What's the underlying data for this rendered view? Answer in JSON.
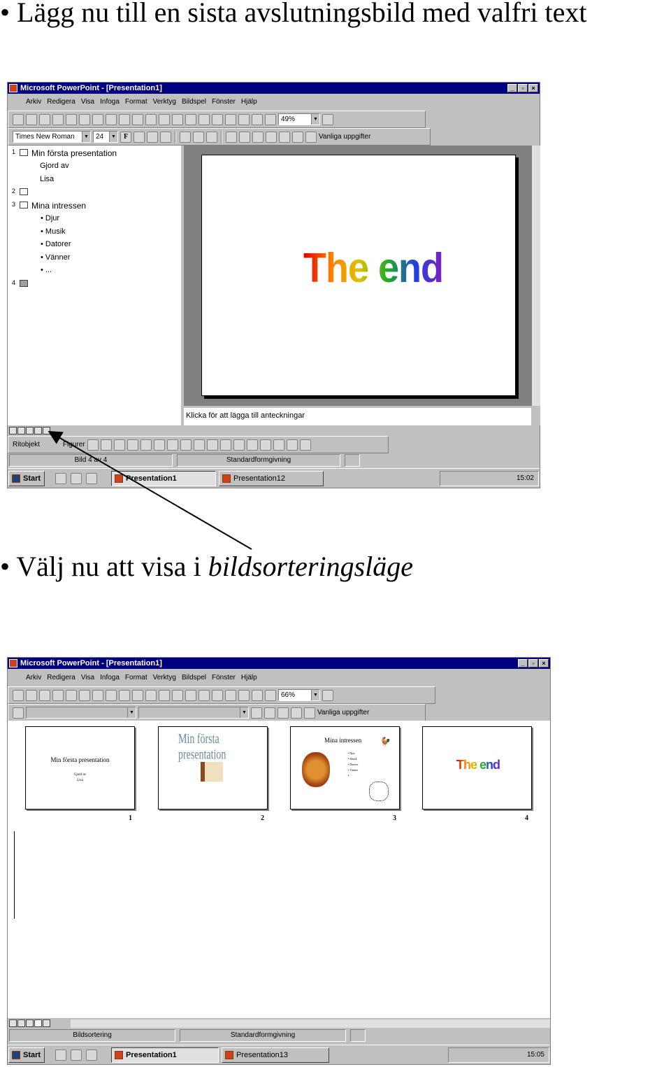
{
  "bullets": {
    "b1": "• Lägg nu till en sista avslutningsbild med valfri text",
    "b2_prefix": "• Välj nu att visa i ",
    "b2_italic": "bildsorteringsläge"
  },
  "shot1": {
    "title": "Microsoft PowerPoint - [Presentation1]",
    "menu": [
      "Arkiv",
      "Redigera",
      "Visa",
      "Infoga",
      "Format",
      "Verktyg",
      "Bildspel",
      "Fönster",
      "Hjälp"
    ],
    "zoom": "49%",
    "font": "Times New Roman",
    "size": "24",
    "task_pane": "Vanliga uppgifter",
    "outline": [
      {
        "num": "1",
        "title": "Min första presentation",
        "lines": [
          "Gjord av",
          "Lisa"
        ]
      },
      {
        "num": "2",
        "title": "",
        "lines": []
      },
      {
        "num": "3",
        "title": "Mina intressen",
        "lines": [
          "• Djur",
          "• Musik",
          "• Datorer",
          "• Vänner",
          "• ..."
        ]
      },
      {
        "num": "4",
        "title": "",
        "lines": []
      }
    ],
    "slide_text": "The end",
    "notes_placeholder": "Klicka för att lägga till anteckningar",
    "draw_label": "Ritobjekt",
    "shapes_label": "Figurer",
    "status_slide": "Bild 4 av 4",
    "status_design": "Standardformgivning",
    "start": "Start",
    "task1": "Presentation1",
    "task2": "Presentation12",
    "clock": "15:02"
  },
  "shot2": {
    "title": "Microsoft PowerPoint - [Presentation1]",
    "menu": [
      "Arkiv",
      "Redigera",
      "Visa",
      "Infoga",
      "Format",
      "Verktyg",
      "Bildspel",
      "Fönster",
      "Hjälp"
    ],
    "zoom": "66%",
    "task_pane": "Vanliga uppgifter",
    "thumbs": [
      {
        "num": "1",
        "title": "Min första presentation",
        "sub1": "Gjord av",
        "sub2": "Lisa"
      },
      {
        "num": "2",
        "title": "Min första presentation"
      },
      {
        "num": "3",
        "title": "Mina intressen",
        "bullets": [
          "• Djur",
          "• Musik",
          "• Datorer",
          "• Vänner",
          "•"
        ]
      },
      {
        "num": "4",
        "title": "The end"
      }
    ],
    "status_view": "Bildsortering",
    "status_design": "Standardformgivning",
    "start": "Start",
    "task1": "Presentation1",
    "task2": "Presentation13",
    "clock": "15:05"
  },
  "icons": {
    "toolbar1": [
      "new-icon",
      "open-icon",
      "save-icon",
      "email-icon",
      "print-icon",
      "spelling-icon",
      "cut-icon",
      "copy-icon",
      "paste-icon",
      "format-painter-icon",
      "undo-icon",
      "redo-icon",
      "hyperlink-icon",
      "tables-borders-icon",
      "insert-table-icon",
      "insert-chart-icon",
      "new-slide-icon",
      "expand-all-icon",
      "show-formatting-icon",
      "grayscale-icon"
    ],
    "drawing": [
      "select-arrow-icon",
      "free-rotate-icon",
      "line-icon",
      "arrow-icon",
      "rectangle-icon",
      "oval-icon",
      "textbox-icon",
      "wordart-icon",
      "clipart-icon",
      "fill-color-icon",
      "line-color-icon",
      "font-color-icon",
      "line-style-icon",
      "dash-style-icon",
      "arrow-style-icon",
      "shadow-icon",
      "3d-icon"
    ]
  },
  "colors": {
    "titlebar": "#000080",
    "chrome": "#c0c0c0",
    "slide_pane": "#808080"
  }
}
